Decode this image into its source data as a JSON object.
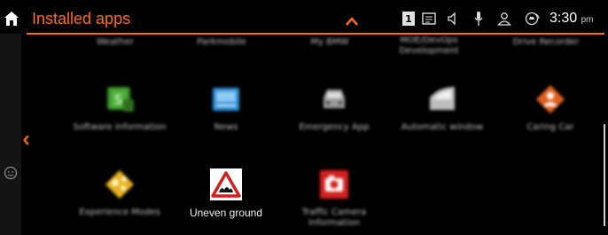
{
  "header": {
    "title": "Installed apps",
    "time": "3:30",
    "ampm": "pm",
    "screen_number": "1"
  },
  "top_row_labels": [
    "Weather",
    "Parkmobile",
    "My BMW",
    "MOE/DevOps Development",
    "Drive Recorder"
  ],
  "apps_row1": [
    {
      "label": "Software information",
      "icon": "software-info-icon"
    },
    {
      "label": "News",
      "icon": "news-icon"
    },
    {
      "label": "Emergency App",
      "icon": "car-app-icon"
    },
    {
      "label": "Automatic window",
      "icon": "window-icon"
    },
    {
      "label": "Caring Car",
      "icon": "caring-car-icon"
    }
  ],
  "apps_row2": [
    {
      "label": "Experience Modes",
      "icon": "experience-modes-icon"
    },
    {
      "label": "Uneven ground",
      "icon": "uneven-ground-icon"
    },
    {
      "label": "Traffic Camera Information",
      "icon": "traffic-camera-icon"
    }
  ],
  "colors": {
    "accent": "#ff6a1a",
    "background": "#000000"
  }
}
